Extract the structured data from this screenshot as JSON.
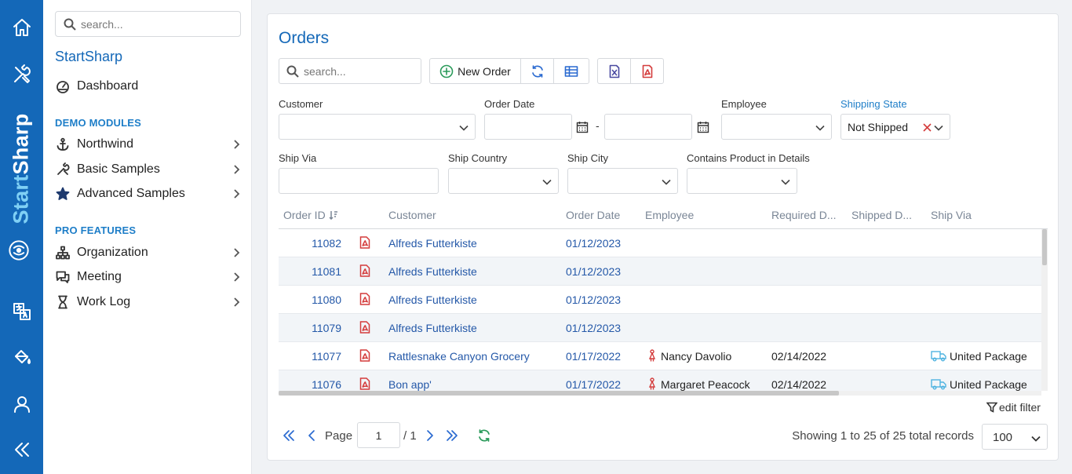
{
  "brand": {
    "part1": "Start",
    "part2": "Sharp"
  },
  "sidebar": {
    "search_placeholder": "search...",
    "title": "StartSharp",
    "dashboard": "Dashboard",
    "demo_section": "DEMO MODULES",
    "demo_items": [
      "Northwind",
      "Basic Samples",
      "Advanced Samples"
    ],
    "pro_section": "PRO FEATURES",
    "pro_items": [
      "Organization",
      "Meeting",
      "Work Log"
    ]
  },
  "page": {
    "title": "Orders"
  },
  "toolbar": {
    "search_placeholder": "search...",
    "new_order": "New Order"
  },
  "filters": {
    "customer": {
      "label": "Customer",
      "value": ""
    },
    "order_date": {
      "label": "Order Date",
      "separator": "-"
    },
    "employee": {
      "label": "Employee",
      "value": ""
    },
    "shipping_state": {
      "label": "Shipping State",
      "value": "Not Shipped"
    },
    "ship_via": {
      "label": "Ship Via"
    },
    "ship_country": {
      "label": "Ship Country"
    },
    "ship_city": {
      "label": "Ship City"
    },
    "contains_product": {
      "label": "Contains Product in Details"
    }
  },
  "grid": {
    "columns": [
      "Order ID",
      "Customer",
      "Order Date",
      "Employee",
      "Required D...",
      "Shipped D...",
      "Ship Via"
    ],
    "rows": [
      {
        "id": "11082",
        "customer": "Alfreds Futterkiste",
        "order_date": "01/12/2023",
        "employee": "",
        "required": "",
        "shipped": "",
        "ship_via": ""
      },
      {
        "id": "11081",
        "customer": "Alfreds Futterkiste",
        "order_date": "01/12/2023",
        "employee": "",
        "required": "",
        "shipped": "",
        "ship_via": ""
      },
      {
        "id": "11080",
        "customer": "Alfreds Futterkiste",
        "order_date": "01/12/2023",
        "employee": "",
        "required": "",
        "shipped": "",
        "ship_via": ""
      },
      {
        "id": "11079",
        "customer": "Alfreds Futterkiste",
        "order_date": "01/12/2023",
        "employee": "",
        "required": "",
        "shipped": "",
        "ship_via": ""
      },
      {
        "id": "11077",
        "customer": "Rattlesnake Canyon Grocery",
        "order_date": "01/17/2022",
        "employee": "Nancy Davolio",
        "required": "02/14/2022",
        "shipped": "",
        "ship_via": "United Package"
      },
      {
        "id": "11076",
        "customer": "Bon app'",
        "order_date": "01/17/2022",
        "employee": "Margaret Peacock",
        "required": "02/14/2022",
        "shipped": "",
        "ship_via": "United Package"
      }
    ],
    "edit_filter": "edit filter"
  },
  "pager": {
    "page_label": "Page",
    "page_value": "1",
    "of_total": "/ 1",
    "status": "Showing 1 to 25 of 25 total records",
    "page_size": "100"
  },
  "colors": {
    "primary": "#1468b8",
    "link": "#2458a8",
    "danger": "#d43c3c",
    "accent": "#4fb3e0"
  }
}
